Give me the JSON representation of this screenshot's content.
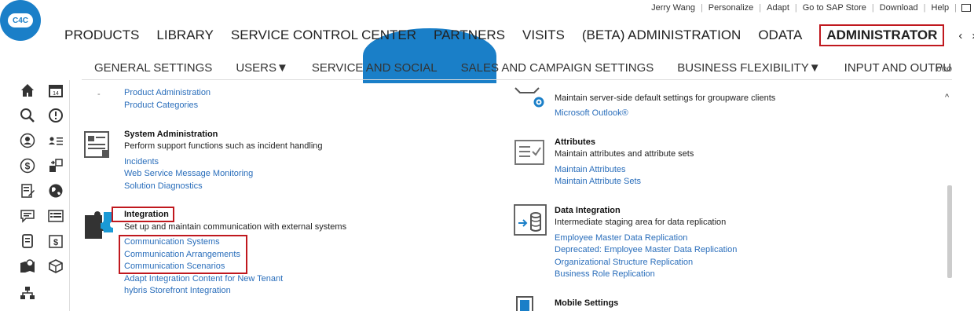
{
  "utility": [
    "Jerry Wang",
    "Personalize",
    "Adapt",
    "Go to SAP Store",
    "Download",
    "Help"
  ],
  "logo": "C4C",
  "main_nav": {
    "items": [
      "PRODUCTS",
      "LIBRARY",
      "SERVICE CONTROL CENTER",
      "PARTNERS",
      "VISITS",
      "(BETA) ADMINISTRATION",
      "ODATA"
    ],
    "active": "ADMINISTRATOR",
    "prev": "‹",
    "next": "›",
    "more": "ooo"
  },
  "sub_nav": {
    "items": [
      "GENERAL SETTINGS",
      "USERS▼",
      "SERVICE AND SOCIAL",
      "SALES AND CAMPAIGN SETTINGS",
      "BUSINESS FLEXIBILITY▼",
      "INPUT AND OUTPU"
    ],
    "prev": "‹",
    "next": "›",
    "more": "ooo"
  },
  "left_sections": {
    "top_links": [
      "Product Administration",
      "Product Categories"
    ],
    "system_admin": {
      "title": "System Administration",
      "desc": "Perform support functions such as incident handling",
      "links": [
        "Incidents",
        "Web Service Message Monitoring",
        "Solution Diagnostics"
      ]
    },
    "integration": {
      "title": "Integration",
      "desc": "Set up and maintain communication with external systems",
      "links": [
        "Communication Systems",
        "Communication Arrangements",
        "Communication Scenarios",
        "Adapt Integration Content for New Tenant",
        "hybris Storefront Integration"
      ]
    }
  },
  "right_sections": {
    "groupware": {
      "desc": "Maintain server-side default settings for groupware clients",
      "links": [
        "Microsoft Outlook®"
      ]
    },
    "attributes": {
      "title": "Attributes",
      "desc": "Maintain attributes and attribute sets",
      "links": [
        "Maintain Attributes",
        "Maintain Attribute Sets"
      ]
    },
    "data_integration": {
      "title": "Data Integration",
      "desc": "Intermediate staging area for data replication",
      "links": [
        "Employee Master Data Replication",
        "Deprecated: Employee Master Data Replication",
        "Organizational Structure Replication",
        "Business Role Replication"
      ]
    },
    "mobile": {
      "title": "Mobile Settings"
    }
  },
  "colors": {
    "accent": "#1a7fc8",
    "highlight": "#c0181e",
    "link": "#2a6ebb"
  }
}
